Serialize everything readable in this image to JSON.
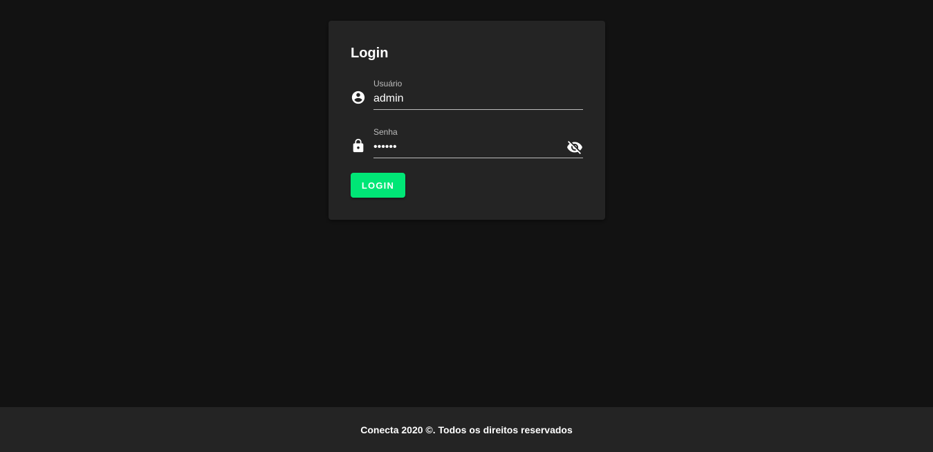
{
  "colors": {
    "background": "#121212",
    "card": "#242424",
    "accent": "#00e676",
    "footer": "#242424"
  },
  "login_card": {
    "title": "Login",
    "username": {
      "label": "Usuário",
      "value": "admin",
      "icon": "account-circle-icon"
    },
    "password": {
      "label": "Senha",
      "value": "••••••",
      "icon": "lock-icon",
      "toggle_icon": "eye-off-icon"
    },
    "submit_label": "LOGIN"
  },
  "footer": {
    "text": "Conecta 2020 ©. Todos os direitos reservados"
  }
}
